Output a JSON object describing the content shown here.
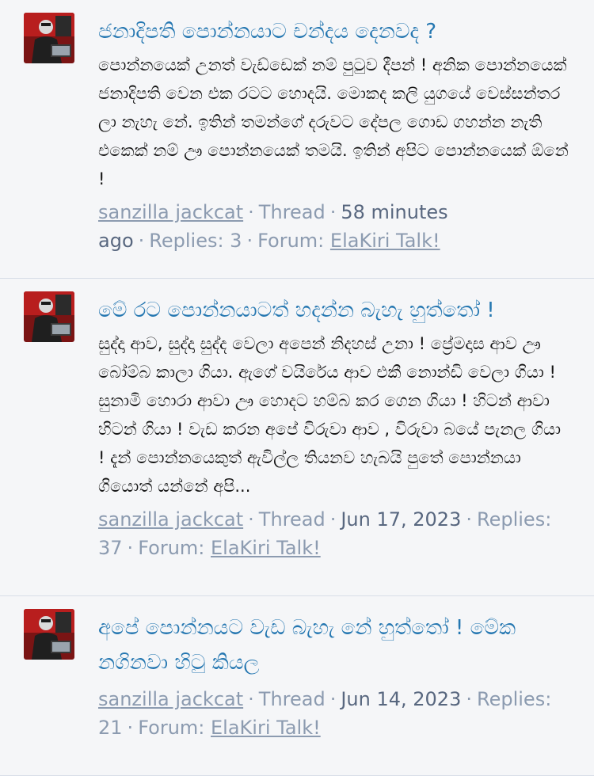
{
  "results": [
    {
      "title": "ජනාදිපති පොන්නයාට චන්දය දෙනවද ?",
      "snippet": "පොන්නයෙක් උනත් වැඩ්ඩෙක් නම් පුටුව දීපන් ! අනික පොන්නයෙක් ජනාදිපති වෙන එක රටට හොදයි. මොකද කලි යුගයේ වෙස්සන්තර ලා නැහැ නේ. ඉතින් තමන්ගේ දරුවට දේපල ගොඩ ගහන්න නැති එකෙක් නම් ඌ පොන්නයෙක් තමයි. ඉතින් අපිට පොන්නයෙක් ඕනේ !",
      "author": "sanzilla jackcat",
      "type": "Thread",
      "date": "58 minutes ago",
      "replies": "Replies: 3",
      "forum_prefix": "Forum:",
      "forum": "ElaKiri Talk!"
    },
    {
      "title": "මේ රට පොන්නයාටත් හදන්න බැහැ හුත්තෝ !",
      "snippet": "සුද්දා ආව, සුද්දා සුද්ද වෙලා අපෙන් නිදහස් උනා ! ප්‍රේමදාස ආව ඌ බෝම්බ කාලා ගියා. ඇගේ වයිරේය ආව එකී නොන්ඩි වෙලා ගියා ! සුනාමි හොරා ආවා ඌ හොදට හම්බ කර ගෙන ගියා ! හිටන් ආවා හිටන් ගියා ! වැඩ කරන අපේ විරුවා ආව , විරුවා බයේ පැනල ගියා ! දැන් පොන්නයෙකුත් ඇවිල්ල තියනව හැබයි පුතේ පොන්නයා ගියොත් යන්නේ අපි...",
      "author": "sanzilla jackcat",
      "type": "Thread",
      "date": "Jun 17, 2023",
      "replies": "Replies: 37",
      "forum_prefix": "Forum:",
      "forum": "ElaKiri Talk!"
    },
    {
      "title": "අපේ පොන්නයට වැඩ බැහැ නේ හුත්තෝ ! මේක නගිනවා හිටු කියල",
      "snippet": "",
      "author": "sanzilla jackcat",
      "type": "Thread",
      "date": "Jun 14, 2023",
      "replies": "Replies: 21",
      "forum_prefix": "Forum:",
      "forum": "ElaKiri Talk!"
    }
  ]
}
